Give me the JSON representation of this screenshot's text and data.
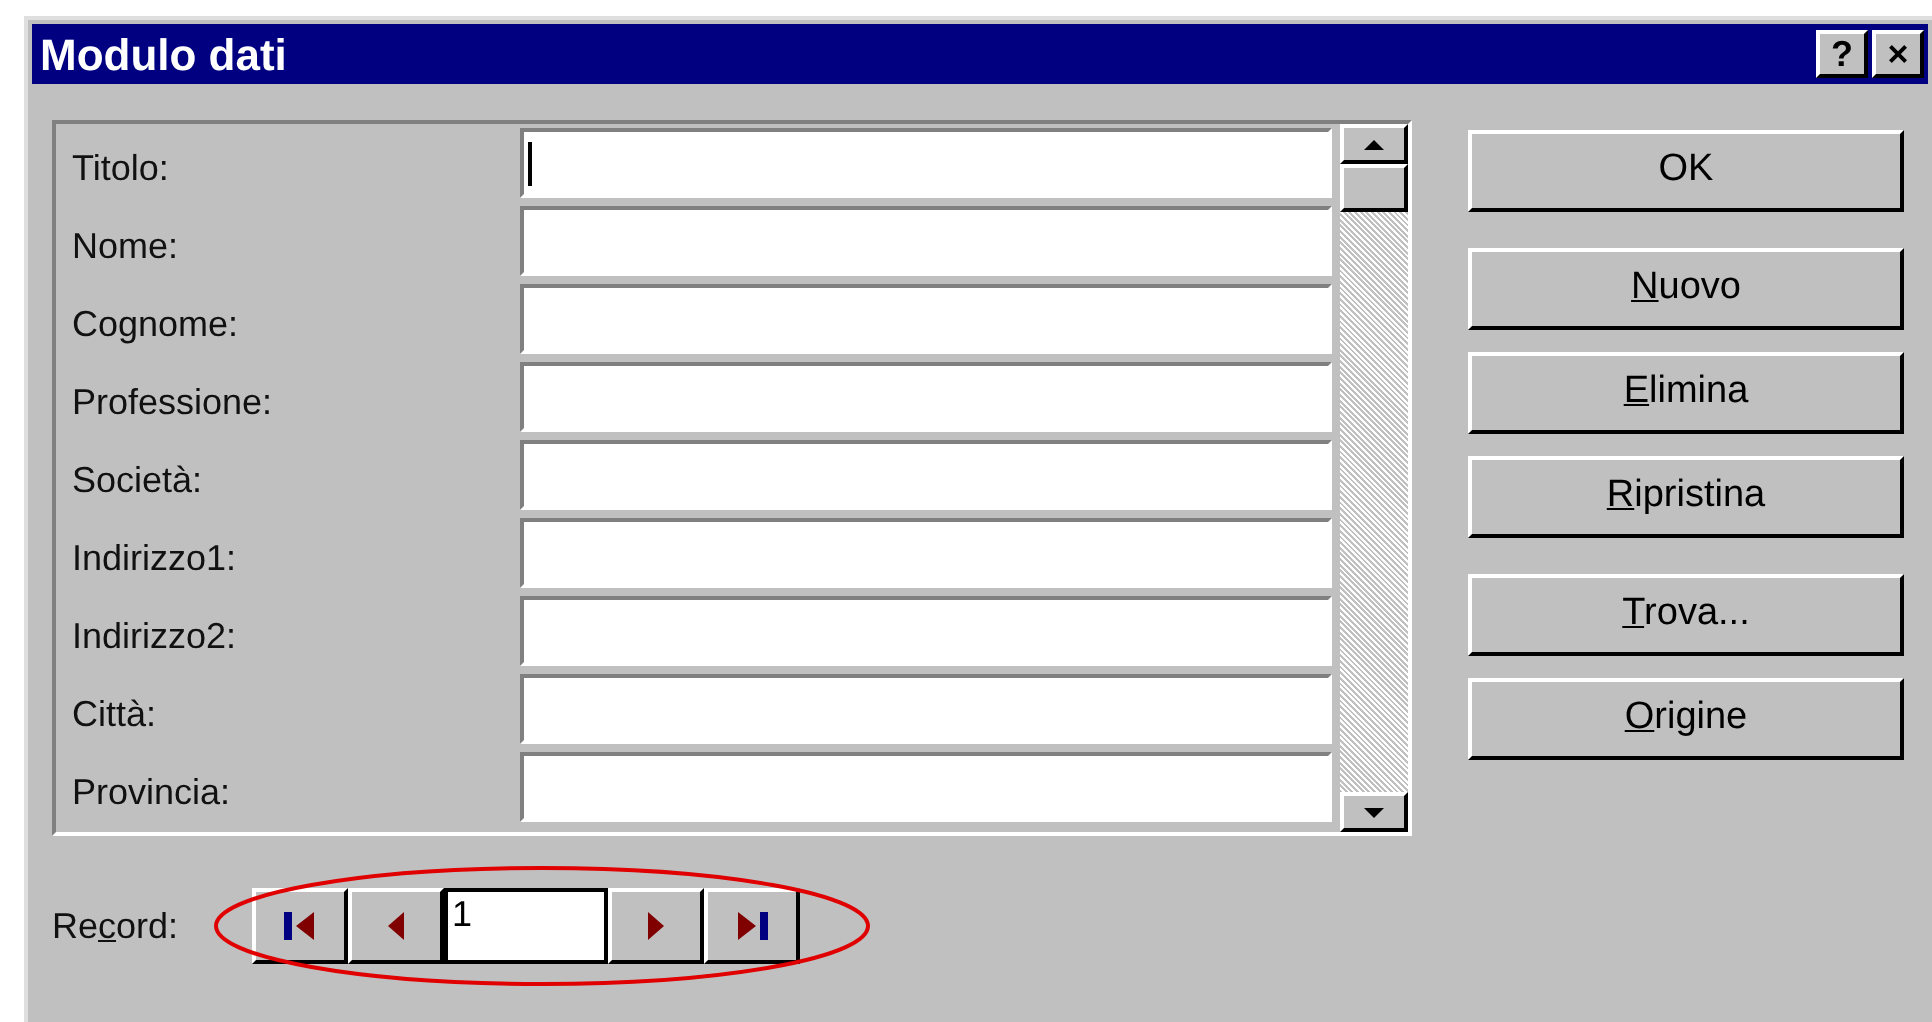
{
  "window": {
    "title": "Modulo dati",
    "title_buttons": [
      "?",
      "×"
    ]
  },
  "fields": [
    {
      "label": "Titolo:",
      "focused": true
    },
    {
      "label": "Nome:",
      "focused": false
    },
    {
      "label": "Cognome:",
      "focused": false
    },
    {
      "label": "Professione:",
      "focused": false
    },
    {
      "label": "Società:",
      "focused": false
    },
    {
      "label": "Indirizzo1:",
      "focused": false
    },
    {
      "label": "Indirizzo2:",
      "focused": false
    },
    {
      "label": "Città:",
      "focused": false
    },
    {
      "label": "Provincia:",
      "focused": false
    }
  ],
  "button_groups": [
    [
      {
        "post": "OK"
      }
    ],
    [
      {
        "key": "N",
        "post": "uovo"
      },
      {
        "key": "E",
        "post": "limina"
      },
      {
        "key": "R",
        "post": "ipristina"
      }
    ],
    [
      {
        "key": "T",
        "post": "rova..."
      },
      {
        "key": "O",
        "post": "rigine"
      }
    ]
  ],
  "record": {
    "label": {
      "pre": "Re",
      "key": "c",
      "post": "ord:"
    },
    "value": "1",
    "highlighted": true
  }
}
